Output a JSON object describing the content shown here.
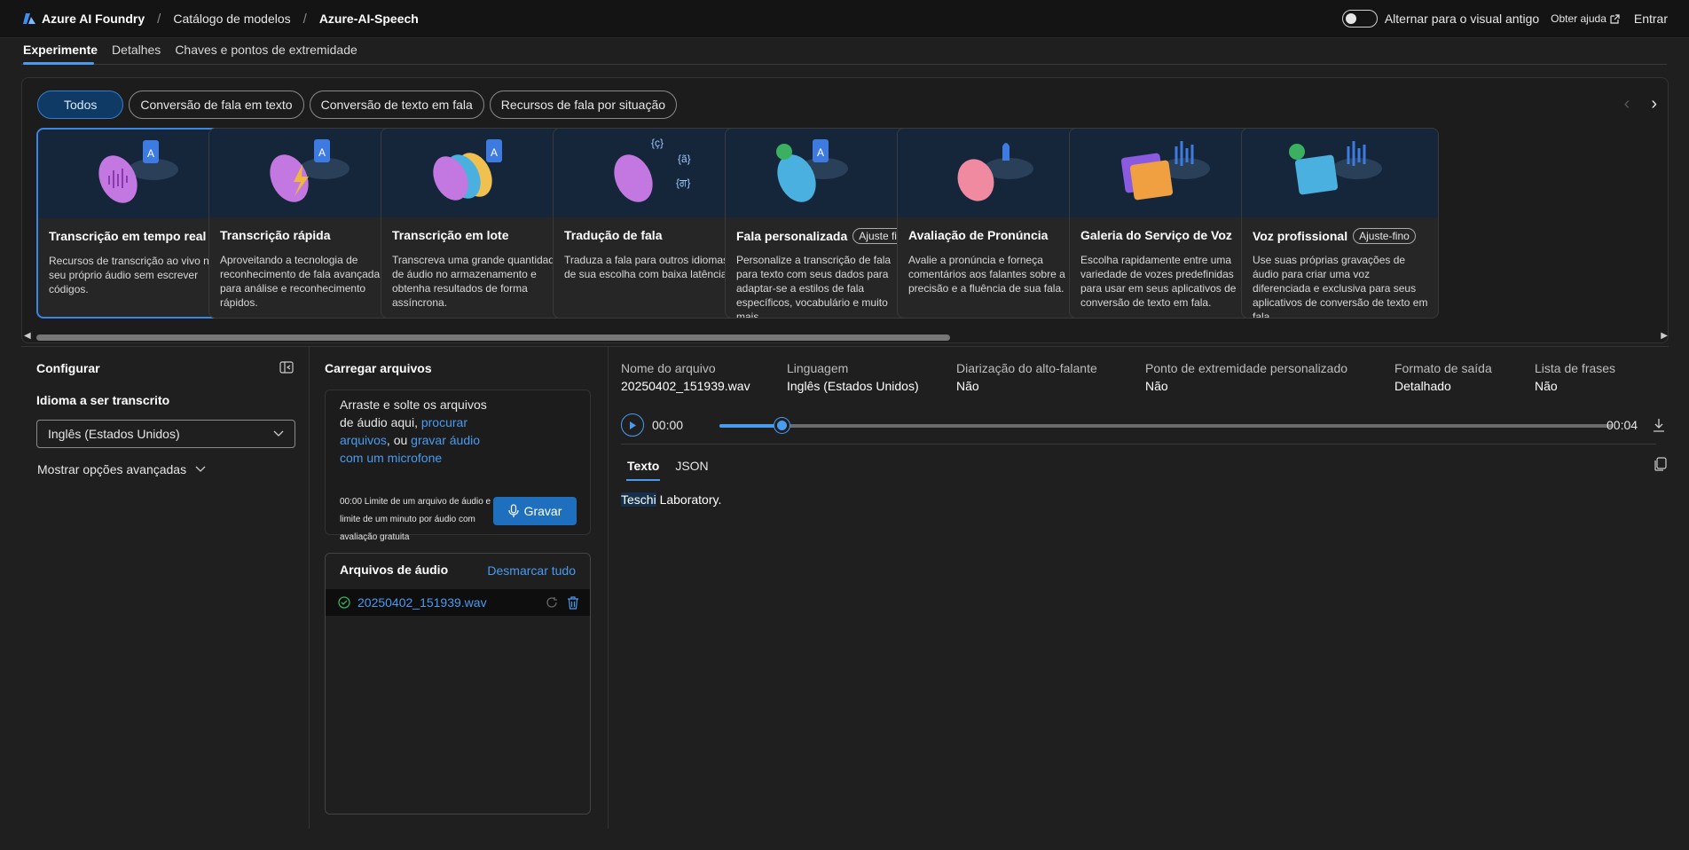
{
  "topbar": {
    "brand": "Azure AI Foundry",
    "breadcrumbs": [
      "Catálogo de modelos",
      "Azure-AI-Speech"
    ],
    "toggle_label": "Alternar para o visual antigo",
    "help_label": "Obter ajuda",
    "signin_label": "Entrar"
  },
  "page_tabs": [
    "Experimente",
    "Detalhes",
    "Chaves e pontos de extremidade"
  ],
  "filters": [
    "Todos",
    "Conversão de fala em texto",
    "Conversão de texto em fala",
    "Recursos de fala por situação"
  ],
  "cards": [
    {
      "title": "Transcrição em tempo real",
      "badge": "",
      "desc": "Recursos de transcrição ao vivo no seu próprio áudio sem escrever códigos."
    },
    {
      "title": "Transcrição rápida",
      "badge": "",
      "desc": "Aproveitando a tecnologia de reconhecimento de fala avançada para análise e reconhecimento rápidos."
    },
    {
      "title": "Transcrição em lote",
      "badge": "",
      "desc": "Transcreva uma grande quantidade de áudio no armazenamento e obtenha resultados de forma assíncrona."
    },
    {
      "title": "Tradução de fala",
      "badge": "",
      "desc": "Traduza a fala para outros idiomas de sua escolha com baixa latência."
    },
    {
      "title": "Fala personalizada",
      "badge": "Ajuste fino",
      "desc": "Personalize a transcrição de fala para texto com seus dados para adaptar-se a estilos de fala específicos, vocabulário e muito mais."
    },
    {
      "title": "Avaliação de Pronúncia",
      "badge": "",
      "desc": "Avalie a pronúncia e forneça comentários aos falantes sobre a precisão e a fluência de sua fala."
    },
    {
      "title": "Galeria do Serviço de Voz",
      "badge": "",
      "desc": "Escolha rapidamente entre uma variedade de vozes predefinidas para usar em seus aplicativos de conversão de texto em fala."
    },
    {
      "title": "Voz profissional",
      "badge": "Ajuste-fino",
      "desc": "Use suas próprias gravações de áudio para criar uma voz diferenciada e exclusiva para seus aplicativos de conversão de texto em fala."
    }
  ],
  "config": {
    "title": "Configurar",
    "language_label": "Idioma a ser transcrito",
    "language_value": "Inglês (Estados Unidos)",
    "advanced_label": "Mostrar opções avançadas"
  },
  "upload": {
    "title": "Carregar arquivos",
    "drop_text_1": "Arraste e solte os arquivos de áudio aqui,",
    "browse_link": "procurar arquivos",
    "drop_text_2": ", ou",
    "record_link": "gravar áudio com um microfone",
    "limit_text": "00:00 Limite de um arquivo de áudio e limite de um minuto por áudio com avaliação gratuita",
    "record_button": "Gravar",
    "files_title": "Arquivos de áudio",
    "deselect_label": "Desmarcar tudo",
    "files": [
      "20250402_151939.wav"
    ]
  },
  "result": {
    "meta": [
      {
        "label": "Nome do arquivo",
        "value": "20250402_151939.wav"
      },
      {
        "label": "Linguagem",
        "value": "Inglês (Estados Unidos)"
      },
      {
        "label": "Diarização do alto-falante",
        "value": "Não"
      },
      {
        "label": "Ponto de extremidade personalizado",
        "value": "Não"
      },
      {
        "label": "Formato de saída",
        "value": "Detalhado"
      },
      {
        "label": "Lista de frases",
        "value": "Não"
      }
    ],
    "time_current": "00:00",
    "time_total": "00:04",
    "playback_progress": 0.07,
    "tabs": [
      "Texto",
      "JSON"
    ],
    "transcript_highlight": "Teschi",
    "transcript_rest": " Laboratory."
  },
  "colors": {
    "accent": "#4a9bf0",
    "button": "#1f6fbf",
    "selected_filter_bg": "#0f3a66"
  }
}
